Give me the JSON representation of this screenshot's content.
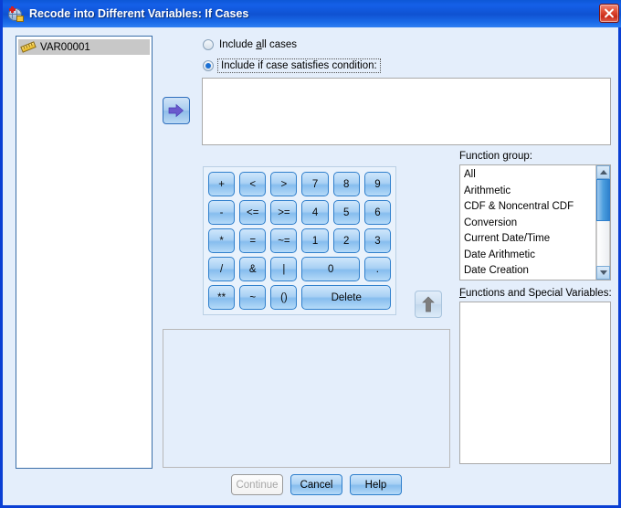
{
  "window": {
    "title": "Recode into Different Variables: If Cases",
    "icon": "spss-recode-icon",
    "close_label": "×"
  },
  "variable_list": {
    "items": [
      {
        "label": "VAR00001",
        "icon": "scale-ruler-icon",
        "selected": true
      }
    ]
  },
  "case_options": {
    "include_all": {
      "label_pre": "Include ",
      "label_key": "a",
      "label_post": "ll cases",
      "selected": false
    },
    "include_condition": {
      "label": "Include if case satisfies condition:",
      "selected": true
    }
  },
  "expression": {
    "value": "",
    "placeholder": ""
  },
  "arrows": {
    "move_variable": "→",
    "move_function": "↑"
  },
  "keypad": {
    "keys": [
      {
        "label": "+",
        "span": 1
      },
      {
        "label": "<",
        "span": 1
      },
      {
        "label": ">",
        "span": 1
      },
      {
        "label": "7",
        "span": 1
      },
      {
        "label": "8",
        "span": 1
      },
      {
        "label": "9",
        "span": 1
      },
      {
        "label": "-",
        "span": 1
      },
      {
        "label": "<=",
        "span": 1
      },
      {
        "label": ">=",
        "span": 1
      },
      {
        "label": "4",
        "span": 1
      },
      {
        "label": "5",
        "span": 1
      },
      {
        "label": "6",
        "span": 1
      },
      {
        "label": "*",
        "span": 1
      },
      {
        "label": "=",
        "span": 1
      },
      {
        "label": "~=",
        "span": 1
      },
      {
        "label": "1",
        "span": 1
      },
      {
        "label": "2",
        "span": 1
      },
      {
        "label": "3",
        "span": 1
      },
      {
        "label": "/",
        "span": 1
      },
      {
        "label": "&",
        "span": 1
      },
      {
        "label": "|",
        "span": 1
      },
      {
        "label": "0",
        "span": 2
      },
      {
        "label": ".",
        "span": 1
      },
      {
        "label": "**",
        "span": 1
      },
      {
        "label": "~",
        "span": 1
      },
      {
        "label": "()",
        "span": 1
      },
      {
        "label": "Delete",
        "span": 3
      }
    ]
  },
  "function_group": {
    "label_pre": "Function ",
    "label_key": "g",
    "label_post": "roup:",
    "items": [
      "All",
      "Arithmetic",
      "CDF & Noncentral CDF",
      "Conversion",
      "Current Date/Time",
      "Date Arithmetic",
      "Date Creation"
    ]
  },
  "functions_special_variables": {
    "label_key": "F",
    "label_post": "unctions and Special Variables:",
    "items": []
  },
  "buttons": {
    "continue": {
      "label": "Continue",
      "enabled": false
    },
    "cancel": {
      "label": "Cancel",
      "enabled": true
    },
    "help": {
      "label": "Help",
      "enabled": true
    }
  },
  "colors": {
    "dialog_bg": "#e4eefb",
    "title_blue": "#1560e8",
    "dialog_border": "#0a3fd4",
    "key_blue": "#86bdee",
    "close_red": "#c92a18",
    "selection_gray": "#c8c8c8"
  }
}
